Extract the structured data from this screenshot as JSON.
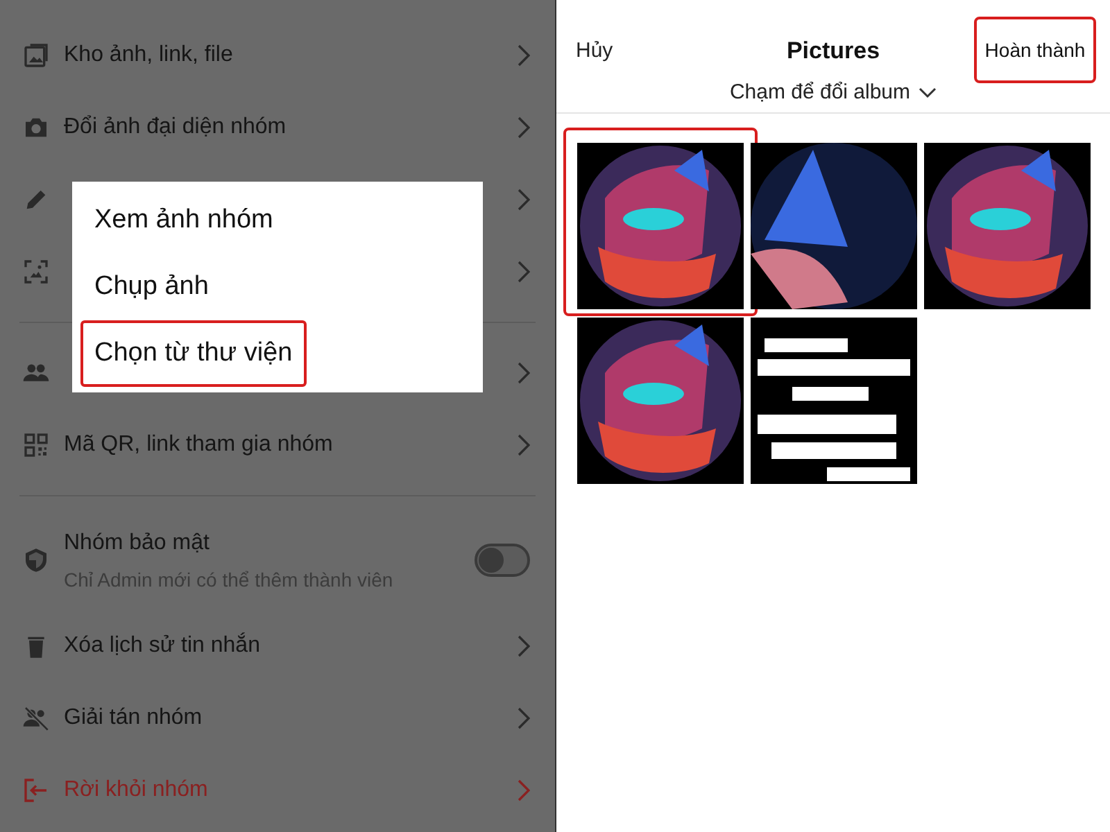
{
  "settings": {
    "groups": [
      {
        "items": [
          {
            "label": "Kho ảnh, link, file",
            "kind": "link"
          },
          {
            "label": "Đổi ảnh đại diện nhóm",
            "kind": "link"
          },
          {
            "kind": "link"
          },
          {
            "kind": "link"
          }
        ]
      },
      {
        "items": [
          {
            "kind": "link"
          },
          {
            "label": "Mã QR, link tham gia nhóm",
            "kind": "link"
          }
        ]
      },
      {
        "items": [
          {
            "label": "Nhóm bảo mật",
            "subtitle": "Chỉ Admin mới có thể thêm thành viên",
            "kind": "toggle",
            "on": false
          },
          {
            "label": "Xóa lịch sử tin nhắn",
            "kind": "link"
          },
          {
            "label": "Giải tán nhóm",
            "kind": "link"
          },
          {
            "label": "Rời khỏi nhóm",
            "kind": "danger"
          }
        ]
      }
    ]
  },
  "popup_menu": {
    "items": [
      {
        "label": "Xem ảnh nhóm",
        "highlighted": false
      },
      {
        "label": "Chụp ảnh",
        "highlighted": false
      },
      {
        "label": "Chọn từ thư viện",
        "highlighted": true
      }
    ]
  },
  "picker": {
    "cancel": "Hủy",
    "title": "Pictures",
    "subtitle": "Chạm để đổi album",
    "done": {
      "label": "Hoàn thành",
      "highlighted": true
    },
    "photos": [
      {
        "kind": "cat",
        "highlighted": true
      },
      {
        "kind": "cat-ear",
        "highlighted": false
      },
      {
        "kind": "cat",
        "highlighted": false
      },
      {
        "kind": "cat",
        "highlighted": false
      },
      {
        "kind": "text-art",
        "highlighted": false
      }
    ]
  }
}
